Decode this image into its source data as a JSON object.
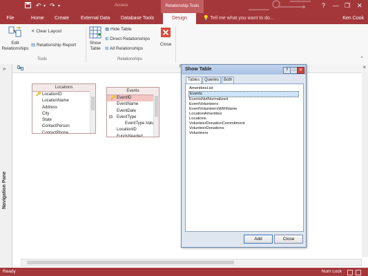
{
  "app": {
    "title": "Access",
    "context_tools": "Relationship Tools",
    "user": "Ken Cook",
    "tell_me_placeholder": "Tell me what you want to do...",
    "window_controls": [
      "?",
      "—",
      "❐",
      "✕"
    ]
  },
  "tabs": [
    "File",
    "Home",
    "Create",
    "External Data",
    "Database Tools",
    "Design"
  ],
  "active_tab": "Design",
  "ribbon": {
    "tools_group": {
      "label": "Tools",
      "edit_relationships": "Edit Relationships",
      "clear_layout": "Clear Layout",
      "relationship_report": "Relationship Report"
    },
    "relationships_group": {
      "label": "Relationships",
      "show_table": "Show Table",
      "hide_table": "Hide Table",
      "direct_relationships": "Direct Relationships",
      "all_relationships": "All Relationships",
      "close": "Close"
    }
  },
  "nav_pane": {
    "label": "Navigation Pane",
    "toggle": "»"
  },
  "doc_tab": {
    "partial_title": "R",
    "close": "×"
  },
  "tables": {
    "locations": {
      "title": "Locations",
      "fields": [
        "LocationID",
        "LocationName",
        "Address",
        "City",
        "State",
        "ContactPerson",
        "ContactPhone"
      ],
      "primary_key": "LocationID"
    },
    "events": {
      "title": "Events",
      "fields": [
        "EventID",
        "EventName",
        "EventDate",
        "EventType",
        "EventType.Valu",
        "LocationID",
        "FundsNeeded"
      ],
      "primary_key": "EventID",
      "expander": "⊟"
    }
  },
  "dialog": {
    "title": "Show Table",
    "tabs": [
      "Tables",
      "Queries",
      "Both"
    ],
    "active_tab": "Tables",
    "items": [
      "AmenitiesList",
      "Events",
      "EventsNotNormalized",
      "EventVolunteers",
      "EventVolunteersWithName",
      "LocationAmenities",
      "Locations",
      "VolunteerDonationCommitment",
      "VolunteerDonations",
      "Volunteers"
    ],
    "selected_item": "Events",
    "add_button": "Add",
    "close_button": "Close",
    "title_buttons": [
      "?",
      "□",
      "✕"
    ]
  },
  "statusbar": {
    "ready": "Ready",
    "num_lock": "Num Lock"
  },
  "colors": {
    "accent": "#a4373a",
    "dialog_bg": "#dfe6f0",
    "selection": "#cde3f9"
  },
  "icons": [
    "save-icon",
    "undo-icon",
    "redo-icon",
    "edit-relationships-icon",
    "eraser-icon",
    "report-icon",
    "show-table-icon",
    "hide-table-icon",
    "direct-relationships-icon",
    "all-relationships-icon",
    "close-x-icon",
    "key-icon",
    "relationships-doc-icon",
    "lightbulb-icon"
  ]
}
